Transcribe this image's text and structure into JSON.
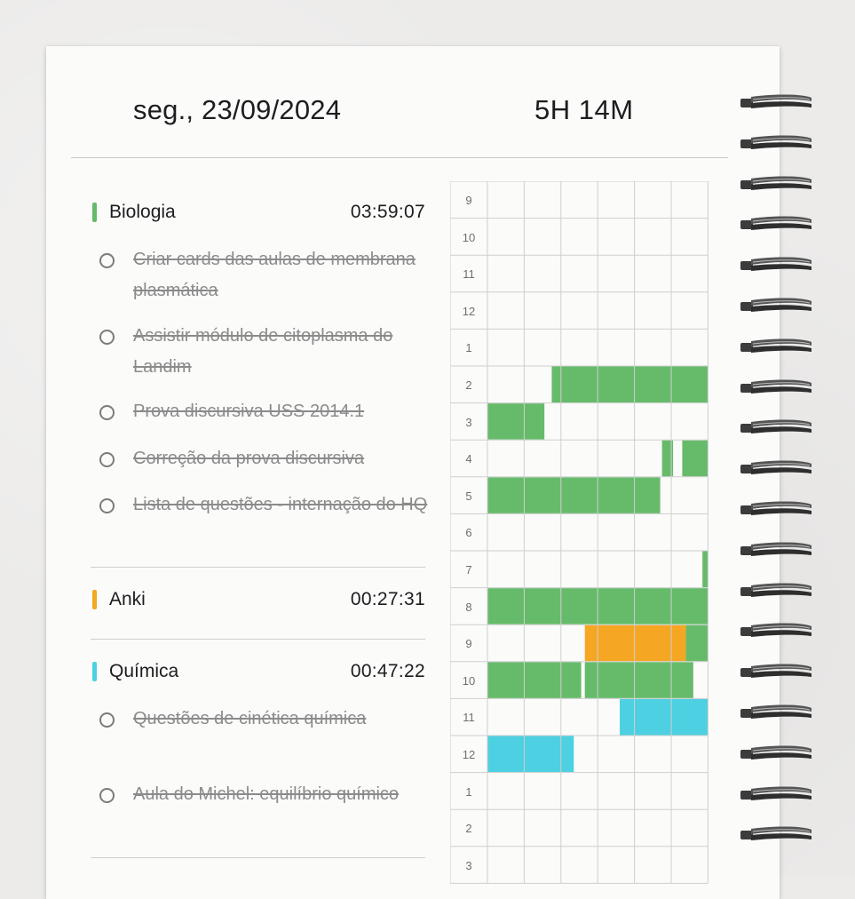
{
  "header": {
    "date": "seg., 23/09/2024",
    "total": "5H 14M"
  },
  "subjects": [
    {
      "name": "Biologia",
      "time": "03:59:07",
      "color": "#66bb6a",
      "tasks": [
        "Criar cards das aulas de membrana plasmática",
        "Assistir módulo de citoplasma do Landim",
        "Prova discursiva USS 2014.1",
        "Correção da prova discursiva",
        "Lista de questões - internação do HQ"
      ]
    },
    {
      "name": "Anki",
      "time": "00:27:31",
      "color": "#f5a623",
      "tasks": []
    },
    {
      "name": "Química",
      "time": "00:47:22",
      "color": "#4dd0e1",
      "tasks": [
        "Questões de cinética química",
        "Aula do Michel: equilíbrio químico"
      ]
    }
  ],
  "timeline": {
    "hours": [
      "9",
      "10",
      "11",
      "12",
      "1",
      "2",
      "3",
      "4",
      "5",
      "6",
      "7",
      "8",
      "9",
      "10",
      "11",
      "12",
      "1",
      "2",
      "3"
    ],
    "blocks": [
      {
        "subject": "Biologia",
        "row": 5,
        "start": 1.75,
        "end": 6
      },
      {
        "subject": "Biologia",
        "row": 6,
        "start": 0,
        "end": 1.55
      },
      {
        "subject": "Biologia",
        "row": 7,
        "start": 4.75,
        "end": 5.05
      },
      {
        "subject": "Biologia",
        "row": 7,
        "start": 5.3,
        "end": 6
      },
      {
        "subject": "Biologia",
        "row": 8,
        "start": 0,
        "end": 4.7
      },
      {
        "subject": "Biologia",
        "row": 10,
        "start": 5.85,
        "end": 6
      },
      {
        "subject": "Biologia",
        "row": 11,
        "start": 0,
        "end": 6
      },
      {
        "subject": "Anki",
        "row": 12,
        "start": 2.65,
        "end": 5.4
      },
      {
        "subject": "Biologia",
        "row": 12,
        "start": 5.4,
        "end": 6
      },
      {
        "subject": "Biologia",
        "row": 13,
        "start": 0,
        "end": 2.55
      },
      {
        "subject": "Biologia",
        "row": 13,
        "start": 2.65,
        "end": 5.6
      },
      {
        "subject": "Química",
        "row": 14,
        "start": 3.6,
        "end": 6
      },
      {
        "subject": "Química",
        "row": 15,
        "start": 0,
        "end": 2.35
      }
    ]
  }
}
